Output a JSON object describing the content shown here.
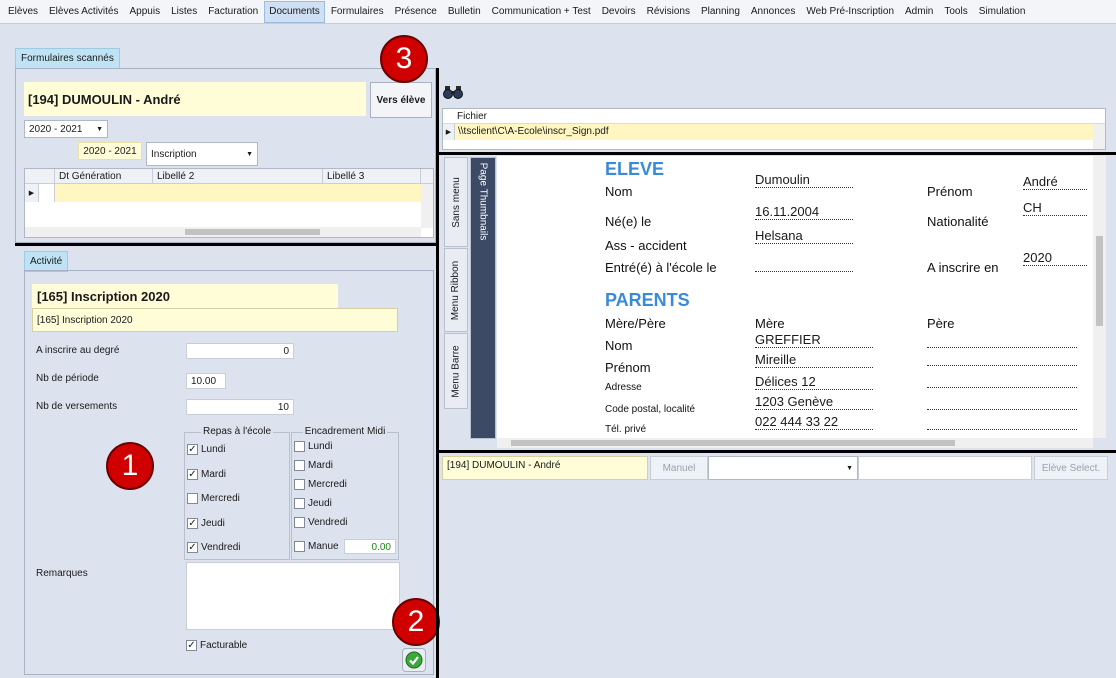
{
  "menu": [
    "Elèves",
    "Elèves Activités",
    "Appuis",
    "Listes",
    "Facturation",
    "Documents",
    "Formulaires",
    "Présence",
    "Bulletin",
    "Communication + Test",
    "Devoirs",
    "Révisions",
    "Planning",
    "Annonces",
    "Web Pré-Inscription",
    "Admin",
    "Tools",
    "Simulation"
  ],
  "active_menu": "Documents",
  "tab_label": "Formulaires scannés",
  "student": {
    "title": "[194] DUMOULIN - André",
    "to_student_button": "Vers élève",
    "year_combo": "2020 - 2021",
    "year_tag": "2020 - 2021",
    "type_combo": "Inscription"
  },
  "grid": {
    "headers": [
      "Dt Génération",
      "Libellé 2",
      "Libellé 3"
    ]
  },
  "activity": {
    "tab_label": "Activité",
    "title": "[165] Inscription 2020",
    "subtitle": "[165] Inscription 2020",
    "fields": {
      "degree_label": "A inscrire au  degré",
      "degree_value": "0",
      "period_label": "Nb de période",
      "period_value": "10.00",
      "payments_label": "Nb de versements",
      "payments_value": "10"
    },
    "meals_title": "Repas à l'école",
    "meals": [
      {
        "label": "Lundi",
        "checked": true
      },
      {
        "label": "Mardi",
        "checked": true
      },
      {
        "label": "Mercredi",
        "checked": false
      },
      {
        "label": "Jeudi",
        "checked": true
      },
      {
        "label": "Vendredi",
        "checked": true
      }
    ],
    "midday_title": "Encadrement Midi",
    "midday": [
      {
        "label": "Lundi",
        "checked": false
      },
      {
        "label": "Mardi",
        "checked": false
      },
      {
        "label": "Mercredi",
        "checked": false
      },
      {
        "label": "Jeudi",
        "checked": false
      },
      {
        "label": "Vendredi",
        "checked": false
      }
    ],
    "manual_label": "Manue",
    "manual_value": "0.00",
    "remarks_label": "Remarques",
    "billable_label": "Facturable",
    "billable_checked": true
  },
  "markers": [
    "1",
    "2",
    "3"
  ],
  "file": {
    "header": "Fichier",
    "path": "\\\\tsclient\\C\\A-Ecole\\inscr_Sign.pdf"
  },
  "viewer_tabs": {
    "thumbnails": "Page Thumbnails",
    "no_menu": "Sans menu",
    "ribbon": "Menu Ribbon",
    "bar": "Menu Barre"
  },
  "pdf": {
    "eleve_heading": "ELEVE",
    "nom_label": "Nom",
    "nom_value": "Dumoulin",
    "prenom_label": "Prénom",
    "prenom_value": "André",
    "ne_label": "Né(e) le",
    "ne_value": "16.11.2004",
    "nat_label": "Nationalité",
    "nat_value": "CH",
    "ass_label": "Ass - accident",
    "ass_value": "Helsana",
    "entre_label": "Entré(é) à l'école le",
    "inscrire_label": "A inscrire en",
    "inscrire_value": "2020",
    "parents_heading": "PARENTS",
    "mp_label": "Mère/Père",
    "mere_label": "Mère",
    "pere_label": "Père",
    "pnom_label": "Nom",
    "pnom_value": "GREFFIER",
    "pprenom_label": "Prénom",
    "pprenom_value": "Mireille",
    "adresse_label": "Adresse",
    "adresse_value": "Délices 12",
    "cp_label": "Code postal, localité",
    "cp_value": "1203 Genève",
    "tel_label": "Tél. privé",
    "tel_value": "022 444 33 22"
  },
  "bottom": {
    "student": "[194] DUMOULIN - André",
    "manual_label": "Manuel",
    "select_button": "Elève Select."
  },
  "colors": {
    "accent_tab": "#bfe3f4",
    "yellow": "#fffcd8",
    "marker": "#d00000",
    "pdf_heading": "#3b8ad6"
  }
}
